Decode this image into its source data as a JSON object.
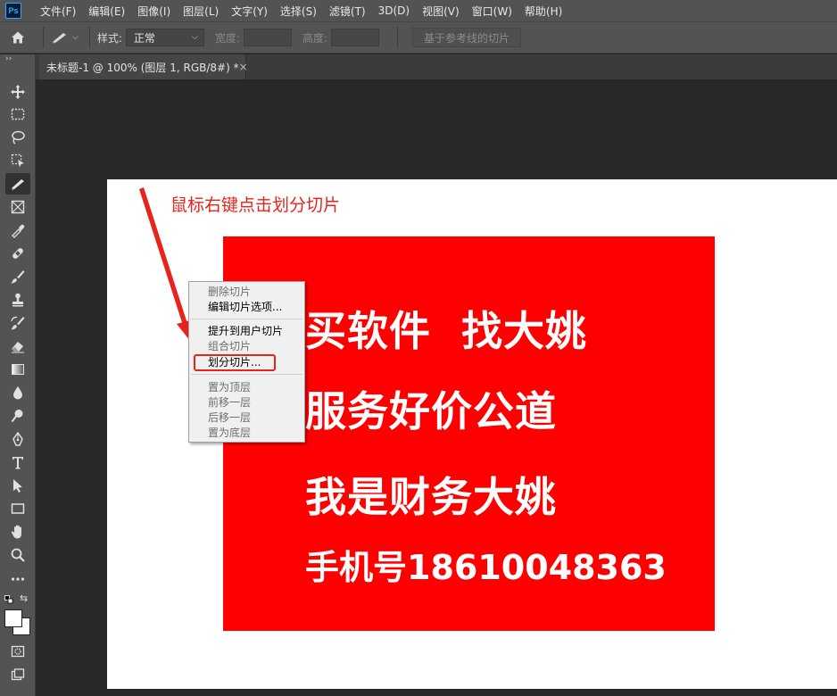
{
  "app": {
    "logo": "Ps"
  },
  "menubar": {
    "items": [
      "文件(F)",
      "编辑(E)",
      "图像(I)",
      "图层(L)",
      "文字(Y)",
      "选择(S)",
      "滤镜(T)",
      "3D(D)",
      "视图(V)",
      "窗口(W)",
      "帮助(H)"
    ]
  },
  "options": {
    "style_label": "样式:",
    "style_value": "正常",
    "width_label": "宽度:",
    "height_label": "高度:",
    "guides_button": "基于参考线的切片"
  },
  "document_tab": {
    "title": "未标题-1 @ 100% (图层 1, RGB/8#) *",
    "close": "×"
  },
  "canvas": {
    "annotation": "鼠标右键点击划分切片",
    "lines": [
      "买软件  找大姚",
      "服务好价公道",
      "我是财务大姚",
      "手机号18610048363"
    ]
  },
  "context_menu": {
    "items": [
      {
        "label": "删除切片",
        "enabled": false
      },
      {
        "label": "编辑切片选项...",
        "enabled": true
      },
      {
        "label": "提升到用户切片",
        "enabled": true
      },
      {
        "label": "组合切片",
        "enabled": false
      },
      {
        "label": "划分切片...",
        "enabled": true
      },
      {
        "label": "置为顶层",
        "enabled": false
      },
      {
        "label": "前移一层",
        "enabled": false
      },
      {
        "label": "后移一层",
        "enabled": false
      },
      {
        "label": "置为底层",
        "enabled": false
      }
    ]
  },
  "colors": {
    "red_box": "#ff0000",
    "annotation": "#e8231b",
    "ui_panel": "#535353",
    "workspace": "#282828"
  },
  "icons": {
    "home": "home-icon",
    "slice_tool": "slice-tool-icon"
  }
}
